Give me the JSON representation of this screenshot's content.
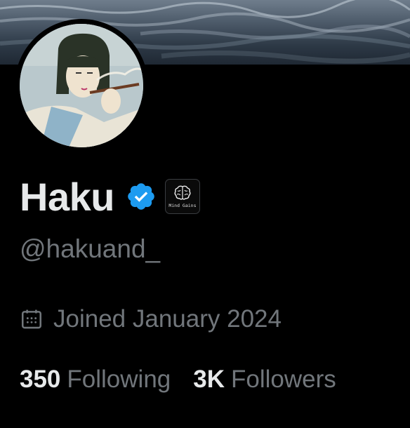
{
  "profile": {
    "display_name": "Haku",
    "handle": "@hakuand_",
    "verified_icon": "verified-check-icon",
    "affiliate_badge_label": "Mind Gains",
    "joined": "Joined January 2024",
    "joined_icon": "calendar-icon",
    "following_count": "350",
    "following_label": "Following",
    "followers_count": "3K",
    "followers_label": "Followers"
  },
  "colors": {
    "background": "#000000",
    "primary_text": "#e7e9ea",
    "secondary_text": "#71767b",
    "verified_blue": "#1d9bf0"
  }
}
